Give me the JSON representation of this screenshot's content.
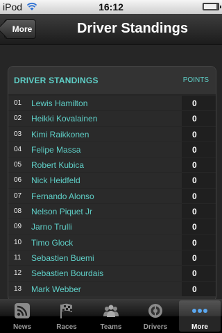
{
  "status_bar": {
    "carrier": "iPod",
    "time": "16:12",
    "battery": 0.9
  },
  "nav": {
    "back_label": "More",
    "title": "Driver Standings"
  },
  "table": {
    "header_title": "DRIVER STANDINGS",
    "header_points": "POINTS",
    "rows": [
      {
        "pos": "01",
        "name": "Lewis Hamilton",
        "points": "0"
      },
      {
        "pos": "02",
        "name": "Heikki Kovalainen",
        "points": "0"
      },
      {
        "pos": "03",
        "name": "Kimi Raikkonen",
        "points": "0"
      },
      {
        "pos": "04",
        "name": "Felipe Massa",
        "points": "0"
      },
      {
        "pos": "05",
        "name": "Robert Kubica",
        "points": "0"
      },
      {
        "pos": "06",
        "name": "Nick Heidfeld",
        "points": "0"
      },
      {
        "pos": "07",
        "name": "Fernando Alonso",
        "points": "0"
      },
      {
        "pos": "08",
        "name": "Nelson Piquet Jr",
        "points": "0"
      },
      {
        "pos": "09",
        "name": "Jarno Trulli",
        "points": "0"
      },
      {
        "pos": "10",
        "name": "Timo Glock",
        "points": "0"
      },
      {
        "pos": "11",
        "name": "Sebastien Buemi",
        "points": "0"
      },
      {
        "pos": "12",
        "name": "Sebastien Bourdais",
        "points": "0"
      },
      {
        "pos": "13",
        "name": "Mark Webber",
        "points": "0"
      }
    ]
  },
  "tab_bar": {
    "tabs": [
      {
        "label": "News",
        "icon": "rss-icon"
      },
      {
        "label": "Races",
        "icon": "checkered-flag-icon"
      },
      {
        "label": "Teams",
        "icon": "people-icon"
      },
      {
        "label": "Drivers",
        "icon": "steering-wheel-icon"
      },
      {
        "label": "More",
        "icon": "more-dots-icon"
      }
    ],
    "active_index": 4
  },
  "colors": {
    "accent": "#5fd0c8",
    "background": "#262626"
  }
}
